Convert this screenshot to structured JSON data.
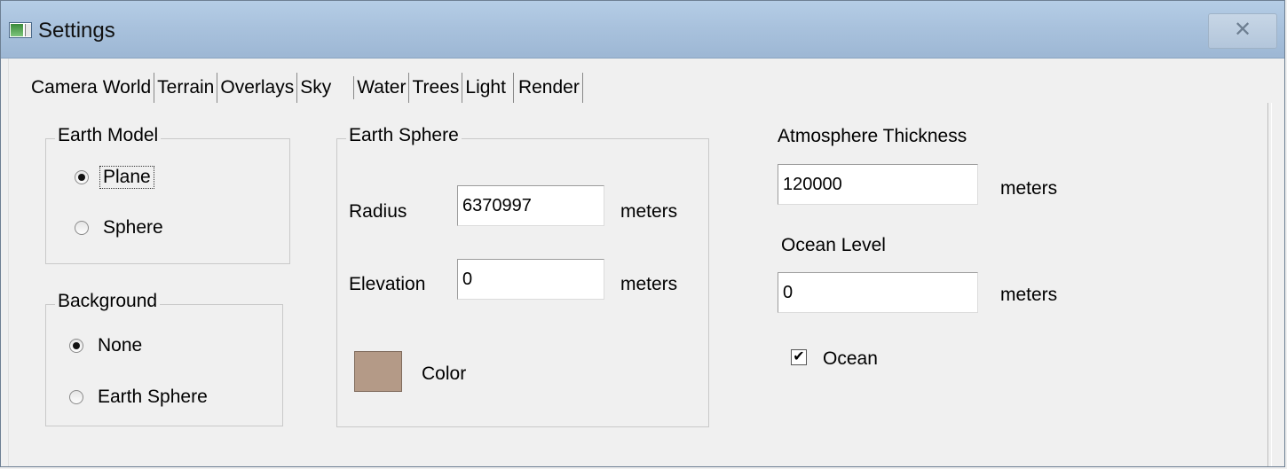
{
  "window": {
    "title": "Settings",
    "close_glyph": "✕"
  },
  "tabs": [
    {
      "label": "Camera"
    },
    {
      "label": "World"
    },
    {
      "label": "Terrain"
    },
    {
      "label": "Overlays"
    },
    {
      "label": "Sky"
    },
    {
      "label": "Water"
    },
    {
      "label": "Trees"
    },
    {
      "label": "Light"
    },
    {
      "label": "Render"
    }
  ],
  "active_tab": "World",
  "earth_model": {
    "title": "Earth Model",
    "options": [
      "Plane",
      "Sphere"
    ],
    "selected": "Plane"
  },
  "background": {
    "title": "Background",
    "options": [
      "None",
      "Earth Sphere"
    ],
    "selected": "None"
  },
  "earth_sphere": {
    "title": "Earth Sphere",
    "radius_label": "Radius",
    "radius_value": "6370997",
    "radius_unit": "meters",
    "elevation_label": "Elevation",
    "elevation_value": "0",
    "elevation_unit": "meters",
    "color_label": "Color",
    "color_hex": "#b49a87"
  },
  "atmosphere": {
    "label": "Atmosphere Thickness",
    "value": "120000",
    "unit": "meters"
  },
  "ocean": {
    "level_label": "Ocean Level",
    "level_value": "0",
    "level_unit": "meters",
    "checkbox_label": "Ocean",
    "checked": true,
    "check_glyph": "✔"
  }
}
